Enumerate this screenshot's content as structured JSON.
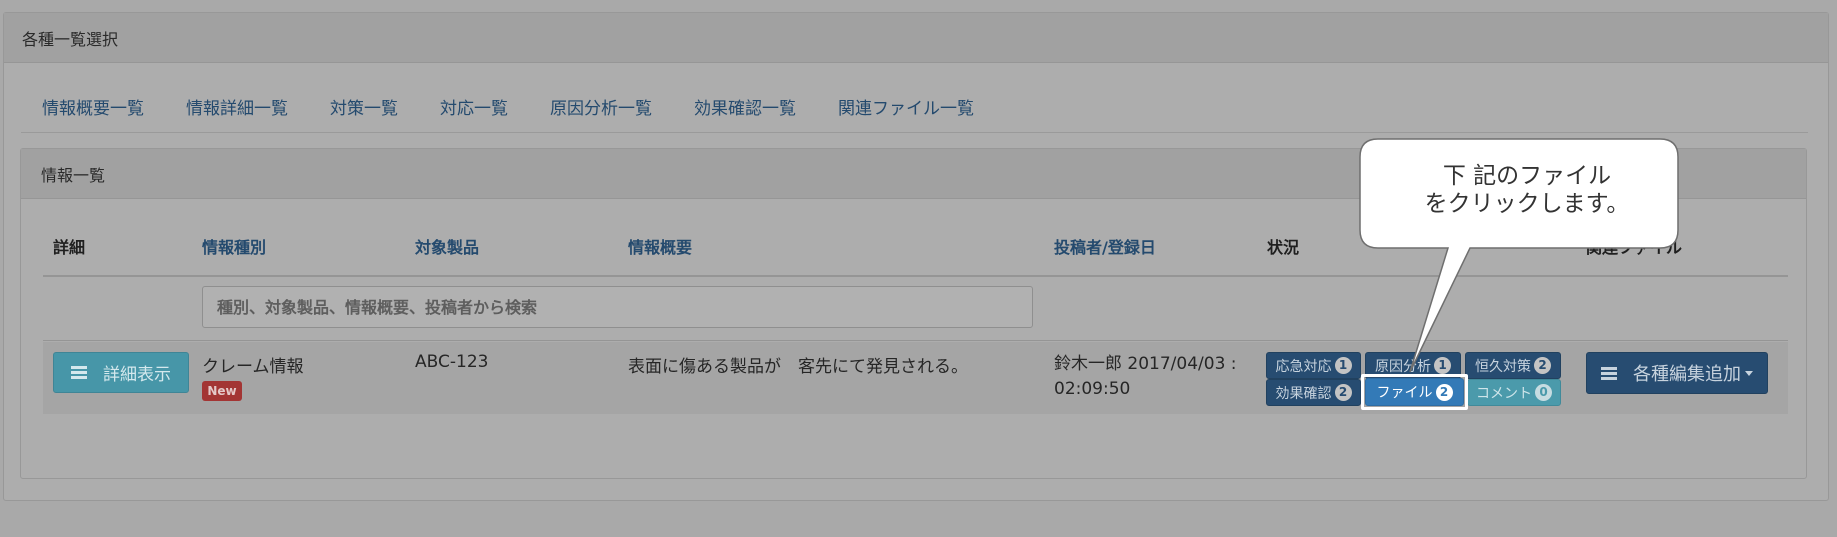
{
  "outer_panel": {
    "title": "各種一覧選択"
  },
  "nav_tabs": [
    "情報概要一覧",
    "情報詳細一覧",
    "対策一覧",
    "対応一覧",
    "原因分析一覧",
    "効果確認一覧",
    "関連ファイル一覧"
  ],
  "inner_panel": {
    "title": "情報一覧"
  },
  "table": {
    "headers": {
      "detail": "詳細",
      "info_type": "情報種別",
      "product": "対象製品",
      "summary": "情報概要",
      "poster_date": "投稿者/登録日",
      "status": "状況",
      "related_files": "関連ファイル"
    },
    "search_placeholder": "種別、対象製品、情報概要、投稿者から検索",
    "rows": [
      {
        "detail_button": "詳細表示",
        "info_type": "クレーム情報",
        "badge": "New",
        "product": "ABC-123",
        "summary": "表面に傷ある製品が　客先にて発見される。",
        "poster_line1": "鈴木一郎 2017/04/03 :",
        "poster_line2": "02:09:50",
        "status_buttons": [
          {
            "label": "応急対応",
            "count": "1"
          },
          {
            "label": "原因分析",
            "count": "1"
          },
          {
            "label": "恒久対策",
            "count": "2"
          },
          {
            "label": "効果確認",
            "count": "2"
          },
          {
            "label": "ファイル",
            "count": "2"
          },
          {
            "label": "コメント",
            "count": "0"
          }
        ],
        "edit_button": "各種編集追加"
      }
    ]
  },
  "callout": {
    "line1": "下 記のファイル",
    "line2": "をクリックします。"
  },
  "colors": {
    "link_blue": "#244a6e",
    "primary_dark": "#274c71",
    "info_teal": "#4b9aab",
    "highlight_primary": "#337ab7",
    "new_badge_red": "#a33534"
  }
}
